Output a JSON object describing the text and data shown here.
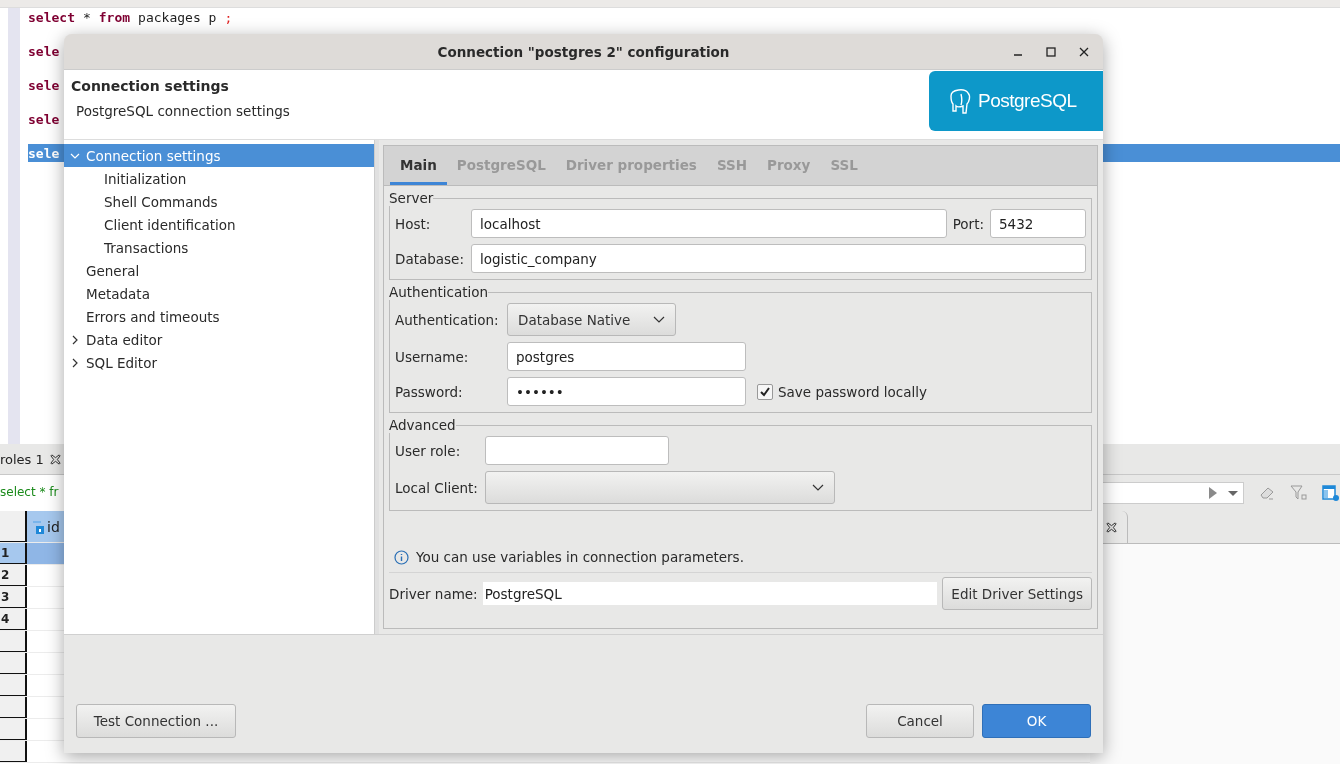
{
  "editor": {
    "lines": [
      {
        "selected": false,
        "tokens": [
          {
            "text": "select",
            "kind": "keyword"
          },
          {
            "text": "*",
            "kind": "plain"
          },
          {
            "text": "from",
            "kind": "keyword"
          },
          {
            "text": "packages p",
            "kind": "plain"
          },
          {
            "text": ";",
            "kind": "punct"
          }
        ]
      },
      {
        "selected": false,
        "tokens": [
          {
            "text": "sele",
            "kind": "keyword"
          }
        ]
      },
      {
        "selected": false,
        "tokens": [
          {
            "text": "sele",
            "kind": "keyword"
          }
        ]
      },
      {
        "selected": false,
        "tokens": [
          {
            "text": "sele",
            "kind": "keyword"
          }
        ]
      },
      {
        "selected": true,
        "tokens": [
          {
            "text": "sele",
            "kind": "keyword"
          }
        ]
      }
    ]
  },
  "results_panel": {
    "tab": "roles 1",
    "query": "select * fr",
    "column": "id",
    "rows": [
      {
        "number": "1",
        "selected": true
      },
      {
        "number": "2",
        "selected": false
      },
      {
        "number": "3",
        "selected": false
      },
      {
        "number": "4",
        "selected": false
      }
    ]
  },
  "dialog": {
    "title": "Connection \"postgres 2\" configuration",
    "header": {
      "title": "Connection settings",
      "subtitle": "PostgreSQL connection settings",
      "logo": "PostgreSQL"
    },
    "nav": [
      {
        "label": "Connection settings",
        "expanded": true,
        "selected": true,
        "children": [
          {
            "label": "Initialization",
            "selected": false
          },
          {
            "label": "Shell Commands",
            "selected": false
          },
          {
            "label": "Client identification",
            "selected": false
          },
          {
            "label": "Transactions",
            "selected": false
          }
        ]
      },
      {
        "label": "General",
        "selected": false
      },
      {
        "label": "Metadata",
        "selected": false
      },
      {
        "label": "Errors and timeouts",
        "selected": false
      },
      {
        "label": "Data editor",
        "expanded": false,
        "selected": false
      },
      {
        "label": "SQL Editor",
        "expanded": false,
        "selected": false
      }
    ],
    "tabs": [
      {
        "label": "Main",
        "selected": true
      },
      {
        "label": "PostgreSQL",
        "selected": false
      },
      {
        "label": "Driver properties",
        "selected": false
      },
      {
        "label": "SSH",
        "selected": false
      },
      {
        "label": "Proxy",
        "selected": false
      },
      {
        "label": "SSL",
        "selected": false
      }
    ],
    "server": {
      "legend": "Server",
      "host_label": "Host:",
      "host": "localhost",
      "port_label": "Port:",
      "port": "5432",
      "database_label": "Database:",
      "database": "logistic_company"
    },
    "authentication": {
      "legend": "Authentication",
      "method_label": "Authentication:",
      "method": "Database Native",
      "username_label": "Username:",
      "username": "postgres",
      "password_label": "Password:",
      "password": "••••••",
      "save_password": {
        "label": "Save password locally",
        "checked": true
      }
    },
    "advanced": {
      "legend": "Advanced",
      "user_role_label": "User role:",
      "local_client_label": "Local Client:"
    },
    "info": "You can use variables in connection parameters.",
    "driver": {
      "label": "Driver name:",
      "value": "PostgreSQL",
      "button": "Edit Driver Settings"
    },
    "buttons": {
      "test": "Test Connection ...",
      "cancel": "Cancel",
      "ok": "OK"
    }
  }
}
